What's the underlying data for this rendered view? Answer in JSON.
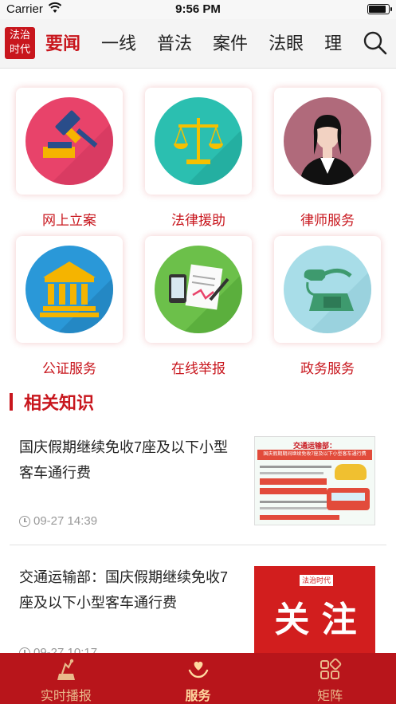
{
  "status_bar": {
    "carrier": "Carrier",
    "time": "9:56 PM",
    "battery_level": 0.9
  },
  "nav": {
    "logo_text": "法治 时代",
    "tabs": [
      "要闻",
      "一线",
      "普法",
      "案件",
      "法眼",
      "理"
    ],
    "active_tab": "要闻"
  },
  "services": [
    {
      "label": "网上立案",
      "icon": "gavel-icon",
      "color": "#e8436a"
    },
    {
      "label": "法律援助",
      "icon": "scales-icon",
      "color": "#2bbfb0"
    },
    {
      "label": "律师服务",
      "icon": "lawyer-icon",
      "color": "#b06a7b"
    },
    {
      "label": "公证服务",
      "icon": "courthouse-icon",
      "color": "#2a98d8"
    },
    {
      "label": "在线举报",
      "icon": "report-icon",
      "color": "#6cc04a"
    },
    {
      "label": "政务服务",
      "icon": "telephone-icon",
      "color": "#a8dde8"
    }
  ],
  "section": {
    "title": "相关知识"
  },
  "articles": [
    {
      "title": "国庆假期继续免收7座及以下小型客车通行费",
      "time": "09-27 14:39",
      "thumb": {
        "heading": "交通运输部：",
        "subheading": "国庆假期期间继续免收7座及以下小型客车通行费"
      }
    },
    {
      "title": "交通运输部：国庆假期继续免收7座及以下小型客车通行费",
      "time": "09-27 10:17",
      "thumb": {
        "brand": "法治时代",
        "heading": "关 注"
      }
    }
  ],
  "tab_bar": {
    "items": [
      {
        "label": "实时播报",
        "icon": "broadcast-icon"
      },
      {
        "label": "服务",
        "icon": "heart-hand-icon"
      },
      {
        "label": "矩阵",
        "icon": "matrix-icon"
      }
    ],
    "active": "服务"
  },
  "colors": {
    "brand_red": "#c8161d",
    "tab_bar_bg": "#b8151b",
    "tab_text": "#e9b98b"
  }
}
